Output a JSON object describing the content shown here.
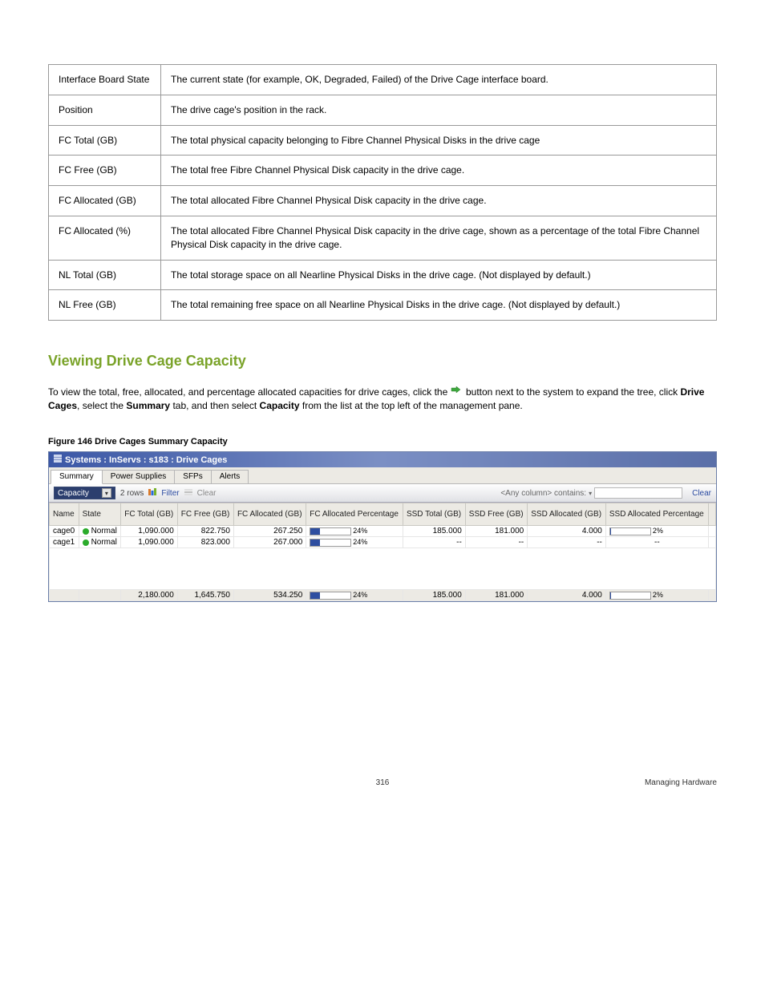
{
  "doc_table": {
    "rows": [
      {
        "c1": "Interface Board State",
        "c2": "The current state (for example, OK, Degraded, Failed) of the Drive Cage interface board."
      },
      {
        "c1": "Position",
        "c2": "The drive cage's position in the rack."
      },
      {
        "c1": "FC Total (GB)",
        "c2": "The total physical capacity belonging to Fibre Channel Physical Disks in the drive cage"
      },
      {
        "c1": "FC Free (GB)",
        "c2": "The total free Fibre Channel Physical Disk capacity in the drive cage."
      },
      {
        "c1": "FC Allocated (GB)",
        "c2": "The total allocated Fibre Channel Physical Disk capacity in the drive cage."
      },
      {
        "c1": "FC Allocated (%)",
        "c2": "The total allocated Fibre Channel Physical Disk capacity in the drive cage, shown as a percentage of the total Fibre Channel Physical Disk capacity in the drive cage."
      },
      {
        "c1": "NL Total (GB)",
        "c2": "The total storage space on all Nearline Physical Disks in the drive cage. (Not displayed by default.)"
      },
      {
        "c1": "NL Free (GB)",
        "c2": "The total remaining free space on all Nearline Physical Disks in the drive cage. (Not displayed by default.)"
      }
    ]
  },
  "heading": "Viewing Drive Cage Capacity",
  "lead_text": "To view the total, free, allocated, and percentage allocated capacities for drive cages, click the  button next to the system to expand the tree, click Drive Cages, select the Summary tab, and then select Capacity from the list at the top left of the management pane.",
  "caption": "Figure 146 Drive Cages Summary Capacity",
  "window": {
    "title": "Systems : InServs : s183 : Drive Cages",
    "tabs": [
      "Summary",
      "Power Supplies",
      "SFPs",
      "Alerts"
    ],
    "active_tab": 0,
    "toolbar": {
      "dropdown": "Capacity",
      "rows": "2 rows",
      "filter_label": "Filter",
      "clear_label": "Clear",
      "filter_field_label": "<Any column> contains:",
      "clear_link": "Clear"
    },
    "columns": [
      "Name",
      "State",
      "FC Total (GB)",
      "FC Free (GB)",
      "FC Allocated (GB)",
      "FC Allocated Percentage",
      "SSD Total (GB)",
      "SSD Free (GB)",
      "SSD Allocated (GB)",
      "SSD Allocated Percentage"
    ],
    "rows": [
      {
        "name": "cage0",
        "state": "Normal",
        "fc_total": "1,090.000",
        "fc_free": "822.750",
        "fc_alloc": "267.250",
        "fc_pct": "24%",
        "fc_pct_val": 24,
        "ssd_total": "185.000",
        "ssd_free": "181.000",
        "ssd_alloc": "4.000",
        "ssd_pct": "2%",
        "ssd_pct_val": 2
      },
      {
        "name": "cage1",
        "state": "Normal",
        "fc_total": "1,090.000",
        "fc_free": "823.000",
        "fc_alloc": "267.000",
        "fc_pct": "24%",
        "fc_pct_val": 24,
        "ssd_total": "--",
        "ssd_free": "--",
        "ssd_alloc": "--",
        "ssd_pct": "--",
        "ssd_pct_val": 0
      }
    ],
    "totals": {
      "fc_total": "2,180.000",
      "fc_free": "1,645.750",
      "fc_alloc": "534.250",
      "fc_pct": "24%",
      "fc_pct_val": 24,
      "ssd_total": "185.000",
      "ssd_free": "181.000",
      "ssd_alloc": "4.000",
      "ssd_pct": "2%",
      "ssd_pct_val": 2
    }
  },
  "footer": {
    "page": "316",
    "right": "Managing Hardware"
  }
}
